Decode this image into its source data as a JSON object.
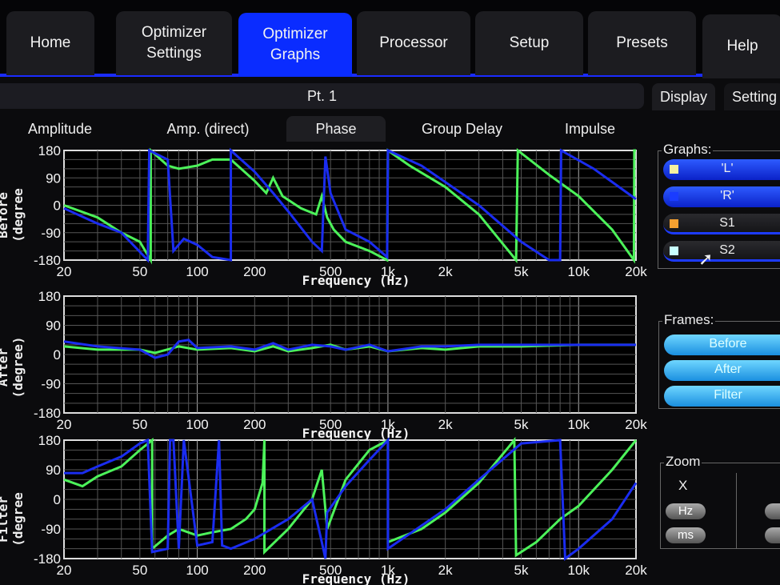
{
  "tabs": [
    "Home",
    "Optimizer Settings",
    "Optimizer Graphs",
    "Processor",
    "Setup",
    "Presets",
    "Help"
  ],
  "header": {
    "title": "Pt. 1"
  },
  "subtabs": [
    "Amplitude",
    "Amp. (direct)",
    "Phase",
    "Group Delay",
    "Impulse"
  ],
  "right_tabs": [
    "Display",
    "Setting"
  ],
  "graphs_panel": {
    "label": "Graphs:",
    "items": [
      {
        "label": "'L'",
        "color": "#f5f0a0"
      },
      {
        "label": "'R'",
        "color": "#1a3cff"
      },
      {
        "label": "S1",
        "color": "#f5a030"
      },
      {
        "label": "S2",
        "color": "#c8ffff"
      }
    ]
  },
  "frames_panel": {
    "label": "Frames:",
    "items": [
      "Before",
      "After",
      "Filter"
    ]
  },
  "zoom_panel": {
    "label": "Zoom",
    "axis": "X",
    "buttons": [
      "Hz",
      "ms"
    ]
  },
  "colors": {
    "green": "#4cf25a",
    "blue": "#1a2cf0",
    "accent": "#0a2cff"
  },
  "chart_data": [
    {
      "type": "line",
      "ylabel": "Before (degree",
      "xlabel": "Frequency (Hz)",
      "xscale": "log",
      "xlim": [
        20,
        20000
      ],
      "ylim": [
        -180,
        180
      ],
      "xticks": [
        20,
        50,
        100,
        200,
        500,
        1000,
        2000,
        5000,
        10000,
        20000
      ],
      "xticklabels": [
        "20",
        "50",
        "100",
        "200",
        "500",
        "1k",
        "2k",
        "5k",
        "10k",
        "20k"
      ],
      "yticks": [
        180,
        90,
        0,
        -90,
        -180
      ],
      "yticklabels": [
        "180",
        "90",
        "0",
        "-90",
        "-180"
      ],
      "series": [
        {
          "name": "green",
          "points": [
            [
              20,
              0
            ],
            [
              30,
              -40
            ],
            [
              40,
              -90
            ],
            [
              50,
              -120
            ],
            [
              57,
              -180
            ],
            [
              57,
              180
            ],
            [
              70,
              130
            ],
            [
              80,
              120
            ],
            [
              100,
              130
            ],
            [
              120,
              150
            ],
            [
              150,
              150
            ],
            [
              200,
              80
            ],
            [
              230,
              40
            ],
            [
              250,
              90
            ],
            [
              280,
              30
            ],
            [
              350,
              -10
            ],
            [
              420,
              -30
            ],
            [
              450,
              30
            ],
            [
              480,
              -40
            ],
            [
              520,
              -80
            ],
            [
              600,
              -120
            ],
            [
              800,
              -150
            ],
            [
              990,
              -180
            ],
            [
              1000,
              180
            ],
            [
              1300,
              130
            ],
            [
              2000,
              60
            ],
            [
              3000,
              -30
            ],
            [
              4700,
              -180
            ],
            [
              4800,
              180
            ],
            [
              7000,
              100
            ],
            [
              10000,
              30
            ],
            [
              15000,
              -80
            ],
            [
              19500,
              -180
            ],
            [
              19600,
              180
            ],
            [
              20000,
              180
            ]
          ]
        },
        {
          "name": "blue",
          "points": [
            [
              20,
              -10
            ],
            [
              30,
              -60
            ],
            [
              40,
              -90
            ],
            [
              55,
              -180
            ],
            [
              56,
              180
            ],
            [
              70,
              150
            ],
            [
              75,
              -150
            ],
            [
              85,
              -110
            ],
            [
              100,
              -130
            ],
            [
              120,
              -170
            ],
            [
              150,
              -180
            ],
            [
              150,
              180
            ],
            [
              200,
              110
            ],
            [
              250,
              40
            ],
            [
              300,
              -20
            ],
            [
              400,
              -120
            ],
            [
              450,
              -150
            ],
            [
              470,
              160
            ],
            [
              500,
              40
            ],
            [
              600,
              -80
            ],
            [
              800,
              -120
            ],
            [
              990,
              -170
            ],
            [
              1000,
              180
            ],
            [
              1500,
              130
            ],
            [
              3000,
              0
            ],
            [
              5000,
              -120
            ],
            [
              7000,
              -180
            ],
            [
              8000,
              -180
            ],
            [
              8100,
              180
            ],
            [
              12000,
              120
            ],
            [
              20000,
              20
            ]
          ]
        }
      ]
    },
    {
      "type": "line",
      "ylabel": "After (degree)",
      "xlabel": "Frequency (Hz)",
      "xscale": "log",
      "xlim": [
        20,
        20000
      ],
      "ylim": [
        -180,
        180
      ],
      "xticks": [
        20,
        50,
        100,
        200,
        500,
        1000,
        2000,
        5000,
        10000,
        20000
      ],
      "xticklabels": [
        "20",
        "50",
        "100",
        "200",
        "500",
        "1k",
        "2k",
        "5k",
        "10k",
        "20k"
      ],
      "yticks": [
        180,
        90,
        0,
        -90,
        -180
      ],
      "yticklabels": [
        "180",
        "90",
        "0",
        "-90",
        "-180"
      ],
      "series": [
        {
          "name": "green",
          "points": [
            [
              20,
              25
            ],
            [
              30,
              15
            ],
            [
              50,
              15
            ],
            [
              60,
              5
            ],
            [
              80,
              25
            ],
            [
              100,
              15
            ],
            [
              150,
              20
            ],
            [
              200,
              10
            ],
            [
              250,
              25
            ],
            [
              300,
              10
            ],
            [
              400,
              20
            ],
            [
              500,
              30
            ],
            [
              600,
              15
            ],
            [
              800,
              25
            ],
            [
              1000,
              10
            ],
            [
              1500,
              20
            ],
            [
              2000,
              15
            ],
            [
              3000,
              25
            ],
            [
              5000,
              25
            ],
            [
              10000,
              30
            ],
            [
              20000,
              30
            ]
          ]
        },
        {
          "name": "blue",
          "points": [
            [
              20,
              40
            ],
            [
              30,
              25
            ],
            [
              50,
              15
            ],
            [
              60,
              -10
            ],
            [
              70,
              0
            ],
            [
              80,
              40
            ],
            [
              90,
              45
            ],
            [
              100,
              20
            ],
            [
              150,
              25
            ],
            [
              200,
              15
            ],
            [
              250,
              35
            ],
            [
              300,
              15
            ],
            [
              400,
              30
            ],
            [
              500,
              25
            ],
            [
              600,
              15
            ],
            [
              800,
              30
            ],
            [
              1000,
              10
            ],
            [
              1500,
              25
            ],
            [
              2000,
              25
            ],
            [
              3000,
              30
            ],
            [
              5000,
              30
            ],
            [
              10000,
              30
            ],
            [
              20000,
              30
            ]
          ]
        }
      ]
    },
    {
      "type": "line",
      "ylabel": "Filter (degree",
      "xlabel": "Frequency (Hz)",
      "xscale": "log",
      "xlim": [
        20,
        20000
      ],
      "ylim": [
        -180,
        180
      ],
      "xticks": [
        20,
        50,
        100,
        200,
        500,
        1000,
        2000,
        5000,
        10000,
        20000
      ],
      "xticklabels": [
        "20",
        "50",
        "100",
        "200",
        "500",
        "1k",
        "2k",
        "5k",
        "10k",
        "20k"
      ],
      "yticks": [
        180,
        90,
        0,
        -90,
        -180
      ],
      "yticklabels": [
        "180",
        "90",
        "0",
        "-90",
        "-180"
      ],
      "series": [
        {
          "name": "green",
          "points": [
            [
              20,
              60
            ],
            [
              25,
              40
            ],
            [
              30,
              70
            ],
            [
              40,
              100
            ],
            [
              50,
              150
            ],
            [
              58,
              180
            ],
            [
              58,
              -150
            ],
            [
              70,
              -110
            ],
            [
              80,
              -90
            ],
            [
              100,
              -110
            ],
            [
              120,
              -100
            ],
            [
              150,
              -90
            ],
            [
              180,
              -60
            ],
            [
              200,
              -30
            ],
            [
              220,
              50
            ],
            [
              225,
              180
            ],
            [
              225,
              -160
            ],
            [
              300,
              -90
            ],
            [
              400,
              0
            ],
            [
              450,
              90
            ],
            [
              480,
              -90
            ],
            [
              600,
              60
            ],
            [
              800,
              150
            ],
            [
              1000,
              180
            ],
            [
              1000,
              -130
            ],
            [
              1500,
              -90
            ],
            [
              2000,
              -40
            ],
            [
              3000,
              50
            ],
            [
              4600,
              180
            ],
            [
              4700,
              -170
            ],
            [
              6000,
              -130
            ],
            [
              8000,
              -60
            ],
            [
              10000,
              -20
            ],
            [
              15000,
              90
            ],
            [
              20000,
              180
            ]
          ]
        },
        {
          "name": "blue",
          "points": [
            [
              20,
              80
            ],
            [
              25,
              80
            ],
            [
              30,
              100
            ],
            [
              40,
              130
            ],
            [
              50,
              170
            ],
            [
              55,
              180
            ],
            [
              58,
              -160
            ],
            [
              70,
              -150
            ],
            [
              72,
              180
            ],
            [
              75,
              180
            ],
            [
              80,
              -150
            ],
            [
              85,
              180
            ],
            [
              100,
              -140
            ],
            [
              120,
              -130
            ],
            [
              130,
              180
            ],
            [
              135,
              -140
            ],
            [
              150,
              -150
            ],
            [
              200,
              -120
            ],
            [
              300,
              -60
            ],
            [
              400,
              0
            ],
            [
              450,
              -130
            ],
            [
              470,
              -180
            ],
            [
              480,
              -40
            ],
            [
              600,
              40
            ],
            [
              800,
              120
            ],
            [
              1000,
              180
            ],
            [
              1000,
              -150
            ],
            [
              2000,
              -30
            ],
            [
              3000,
              60
            ],
            [
              5000,
              170
            ],
            [
              8000,
              180
            ],
            [
              8500,
              -180
            ],
            [
              10000,
              -150
            ],
            [
              15000,
              -60
            ],
            [
              20000,
              50
            ]
          ]
        }
      ]
    }
  ]
}
